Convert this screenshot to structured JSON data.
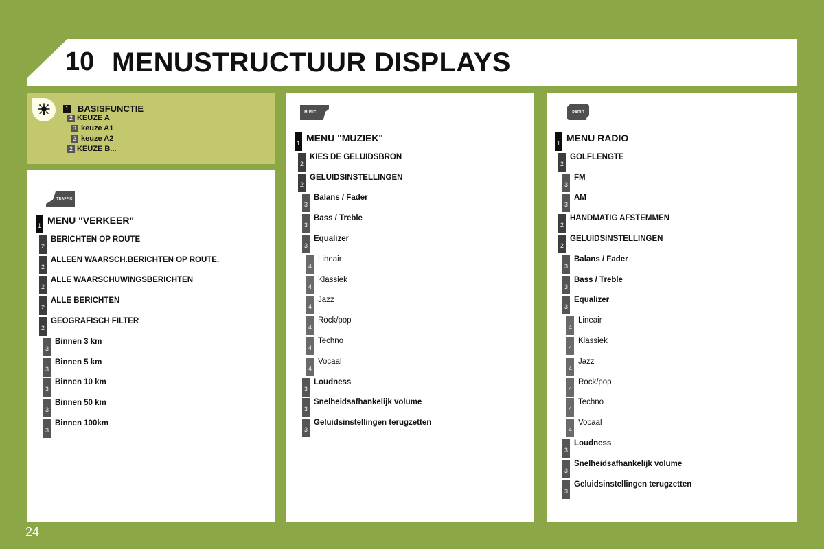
{
  "header": {
    "chapter_number": "10",
    "title": "MENUSTRUCTUUR DISPLAYS"
  },
  "legend": {
    "icon": "light-bulb-icon",
    "items": [
      {
        "level": "1",
        "label": "BASISFUNCTIE"
      },
      {
        "level": "2",
        "label": "KEUZE A"
      },
      {
        "level": "3",
        "label": "keuze A1"
      },
      {
        "level": "3",
        "label": "keuze A2"
      },
      {
        "level": "2",
        "label": "KEUZE B..."
      }
    ]
  },
  "traffic": {
    "icon_label": "TRAFFIC",
    "items": [
      {
        "level": "1",
        "label": "MENU \"VERKEER\""
      },
      {
        "level": "2",
        "label": "BERICHTEN OP ROUTE"
      },
      {
        "level": "2",
        "label": "ALLEEN WAARSCH.BERICHTEN OP ROUTE."
      },
      {
        "level": "2",
        "label": "ALLE WAARSCHUWINGSBERICHTEN"
      },
      {
        "level": "2",
        "label": "ALLE BERICHTEN"
      },
      {
        "level": "2",
        "label": "GEOGRAFISCH FILTER"
      },
      {
        "level": "3",
        "label": "Binnen 3 km"
      },
      {
        "level": "3",
        "label": "Binnen 5 km"
      },
      {
        "level": "3",
        "label": "Binnen 10 km"
      },
      {
        "level": "3",
        "label": "Binnen 50 km"
      },
      {
        "level": "3",
        "label": "Binnen 100km"
      }
    ]
  },
  "music": {
    "icon_label": "MUSIC",
    "items": [
      {
        "level": "1",
        "label": "MENU \"MUZIEK\""
      },
      {
        "level": "2",
        "label": "KIES DE GELUIDSBRON"
      },
      {
        "level": "2",
        "label": "GELUIDSINSTELLINGEN"
      },
      {
        "level": "3",
        "label": "Balans / Fader"
      },
      {
        "level": "3",
        "label": "Bass / Treble"
      },
      {
        "level": "3",
        "label": "Equalizer"
      },
      {
        "level": "4",
        "label": "Lineair"
      },
      {
        "level": "4",
        "label": "Klassiek"
      },
      {
        "level": "4",
        "label": "Jazz"
      },
      {
        "level": "4",
        "label": "Rock/pop"
      },
      {
        "level": "4",
        "label": "Techno"
      },
      {
        "level": "4",
        "label": "Vocaal"
      },
      {
        "level": "3",
        "label": "Loudness"
      },
      {
        "level": "3",
        "label": "Snelheidsafhankelijk volume"
      },
      {
        "level": "3",
        "label": "Geluidsinstellingen terugzetten"
      }
    ]
  },
  "radio": {
    "icon_label": "RADIO",
    "items": [
      {
        "level": "1",
        "label": "MENU RADIO"
      },
      {
        "level": "2",
        "label": "GOLFLENGTE"
      },
      {
        "level": "3",
        "label": "FM"
      },
      {
        "level": "3",
        "label": "AM"
      },
      {
        "level": "2",
        "label": "HANDMATIG AFSTEMMEN"
      },
      {
        "level": "2",
        "label": "GELUIDSINSTELLINGEN"
      },
      {
        "level": "3",
        "label": "Balans / Fader"
      },
      {
        "level": "3",
        "label": "Bass / Treble"
      },
      {
        "level": "3",
        "label": "Equalizer"
      },
      {
        "level": "4",
        "label": "Lineair"
      },
      {
        "level": "4",
        "label": "Klassiek"
      },
      {
        "level": "4",
        "label": "Jazz"
      },
      {
        "level": "4",
        "label": "Rock/pop"
      },
      {
        "level": "4",
        "label": "Techno"
      },
      {
        "level": "4",
        "label": "Vocaal"
      },
      {
        "level": "3",
        "label": "Loudness"
      },
      {
        "level": "3",
        "label": "Snelheidsafhankelijk volume"
      },
      {
        "level": "3",
        "label": "Geluidsinstellingen terugzetten"
      }
    ]
  },
  "footer": {
    "page_number": "24"
  }
}
